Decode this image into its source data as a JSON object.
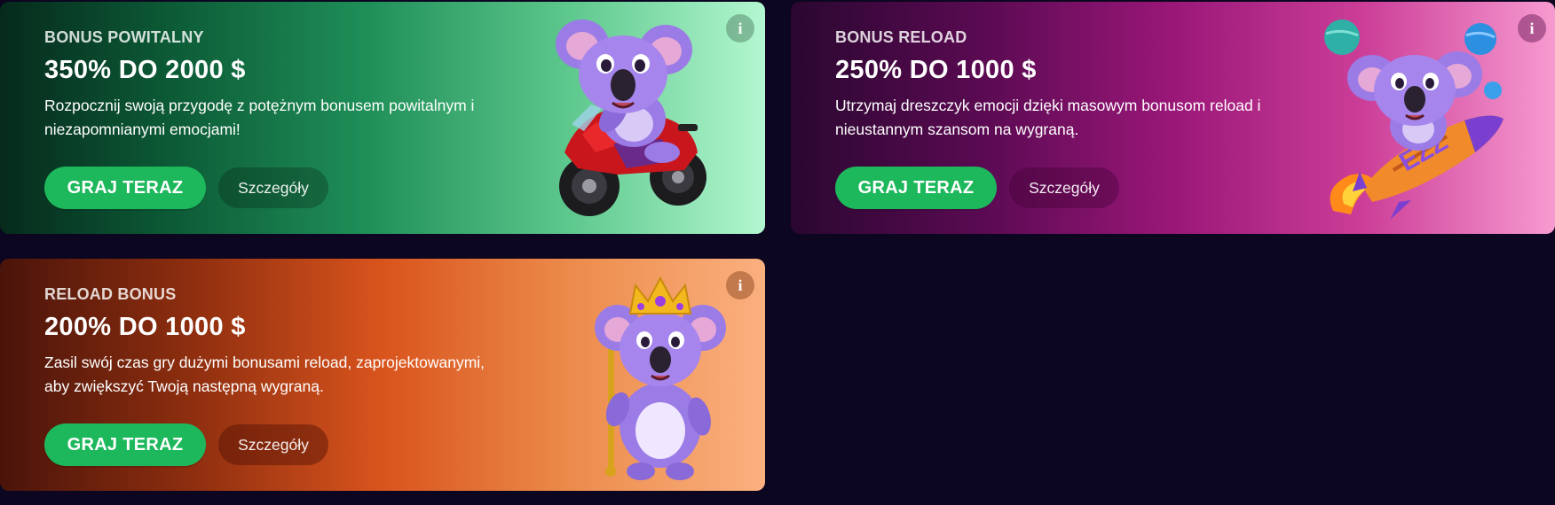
{
  "cards": [
    {
      "eyebrow": "BONUS POWITALNY",
      "headline": "350% DO 2000 $",
      "description": "Rozpocznij swoją przygodę z potężnym bonusem powitalnym i niezapomnianymi emocjami!",
      "play_label": "GRAJ TERAZ",
      "details_label": "Szczegóły",
      "info_icon": "i",
      "mascot": "koala-motorcycle"
    },
    {
      "eyebrow": "BONUS RELOAD",
      "headline": "250% DO 1000 $",
      "description": "Utrzymaj dreszczyk emocji dzięki masowym bonusom reload i nieustannym szansom na wygraną.",
      "play_label": "GRAJ TERAZ",
      "details_label": "Szczegóły",
      "info_icon": "i",
      "mascot": "koala-rocket",
      "mascot_text": "EZZ"
    },
    {
      "eyebrow": "RELOAD BONUS",
      "headline": "200% DO 1000 $",
      "description": "Zasil swój czas gry dużymi bonusami reload, zaprojektowanymi, aby zwiększyć Twoją następną wygraną.",
      "play_label": "GRAJ TERAZ",
      "details_label": "Szczegóły",
      "info_icon": "i",
      "mascot": "koala-king"
    }
  ],
  "colors": {
    "page_bg": "#0c0620",
    "play_button": "#1eb85c",
    "koala_purple": "#9b7be6"
  }
}
